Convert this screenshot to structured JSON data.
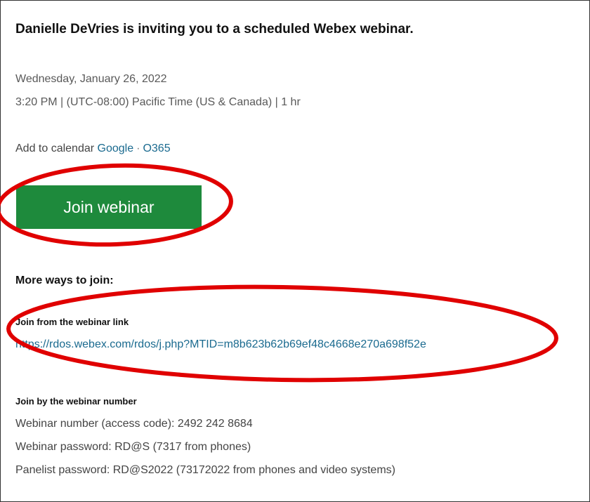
{
  "invite": {
    "title": "Danielle DeVries is inviting you to a scheduled Webex webinar.",
    "date": "Wednesday, January 26, 2022",
    "time": "3:20 PM | (UTC-08:00) Pacific Time (US & Canada) | 1 hr"
  },
  "calendar": {
    "prefix": "Add to calendar",
    "google": "Google",
    "separator": "·",
    "o365": "O365"
  },
  "join_button": {
    "label": "Join webinar",
    "color": "#1e8a3c"
  },
  "more_ways": {
    "heading": "More ways to join:",
    "link_section": {
      "heading": "Join from the webinar link",
      "url": "https://rdos.webex.com/rdos/j.php?MTID=m8b623b62b69ef48c4668e270a698f52e"
    },
    "number_section": {
      "heading": "Join by the webinar number",
      "webinar_number": "Webinar number (access code): 2492 242 8684",
      "webinar_password": "Webinar password: RD@S (7317 from phones)",
      "panelist_password": "Panelist password: RD@S2022 (73172022 from phones and video systems)"
    }
  },
  "colors": {
    "link": "#1a6a8f",
    "annotation": "#e00000"
  }
}
